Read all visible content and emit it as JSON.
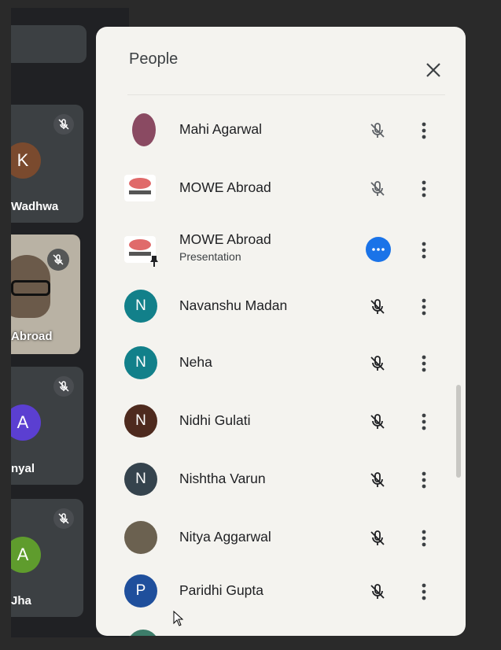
{
  "panel": {
    "title": "People"
  },
  "background_tiles": [
    {
      "label": "Wadhwa",
      "initial": "K",
      "color": "#7a4a2e"
    },
    {
      "label": "Abroad"
    },
    {
      "label": "nyal",
      "initial": "A",
      "color": "#5b3fd1"
    },
    {
      "label": "Jha",
      "initial": "A",
      "color": "#5f9c2d"
    }
  ],
  "people": [
    {
      "name": "Mahi Agarwal",
      "avatar_type": "photo"
    },
    {
      "name": "MOWE Abroad",
      "avatar_type": "logo"
    },
    {
      "name": "MOWE Abroad",
      "subtitle": "Presentation",
      "avatar_type": "logo",
      "presenting": true
    },
    {
      "name": "Navanshu Madan",
      "initial": "N",
      "color": "#12808a"
    },
    {
      "name": "Neha",
      "initial": "N",
      "color": "#12808a"
    },
    {
      "name": "Nidhi Gulati",
      "initial": "N",
      "color": "#4e2a1e"
    },
    {
      "name": "Nishtha Varun",
      "initial": "N",
      "color": "#35434d"
    },
    {
      "name": "Nitya Aggarwal",
      "avatar_type": "photo"
    },
    {
      "name": "Paridhi Gupta",
      "initial": "P",
      "color": "#1f4f9c"
    }
  ],
  "icons": {
    "close": "close-icon",
    "mute": "mic-off-icon",
    "more": "more-vert-icon",
    "present": "more-horiz-icon",
    "pin": "pin-icon"
  }
}
